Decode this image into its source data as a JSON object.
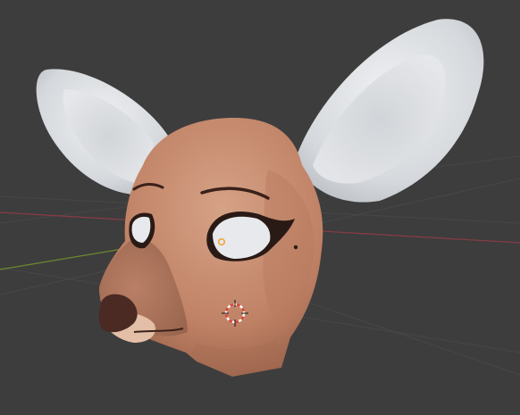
{
  "viewport": {
    "background_color": "#3d3d3d",
    "grid_color": "#474747",
    "x_axis_color": "#8a3b44",
    "y_axis_color": "#6d8a2e",
    "grid": true
  },
  "model": {
    "skin_color": "#c98d70",
    "ear_color": "#dcdee1",
    "nose_color": "#4a2a22",
    "muzzle_color": "#e4bfa7",
    "eye_color": "#e8e9ec",
    "eyeline_color": "#2a1a16"
  },
  "scene_objects": {
    "origin_dot_color": "#f2a53b",
    "cursor_color": "#d84a3a",
    "cursor_icon": "3d-cursor-icon"
  }
}
